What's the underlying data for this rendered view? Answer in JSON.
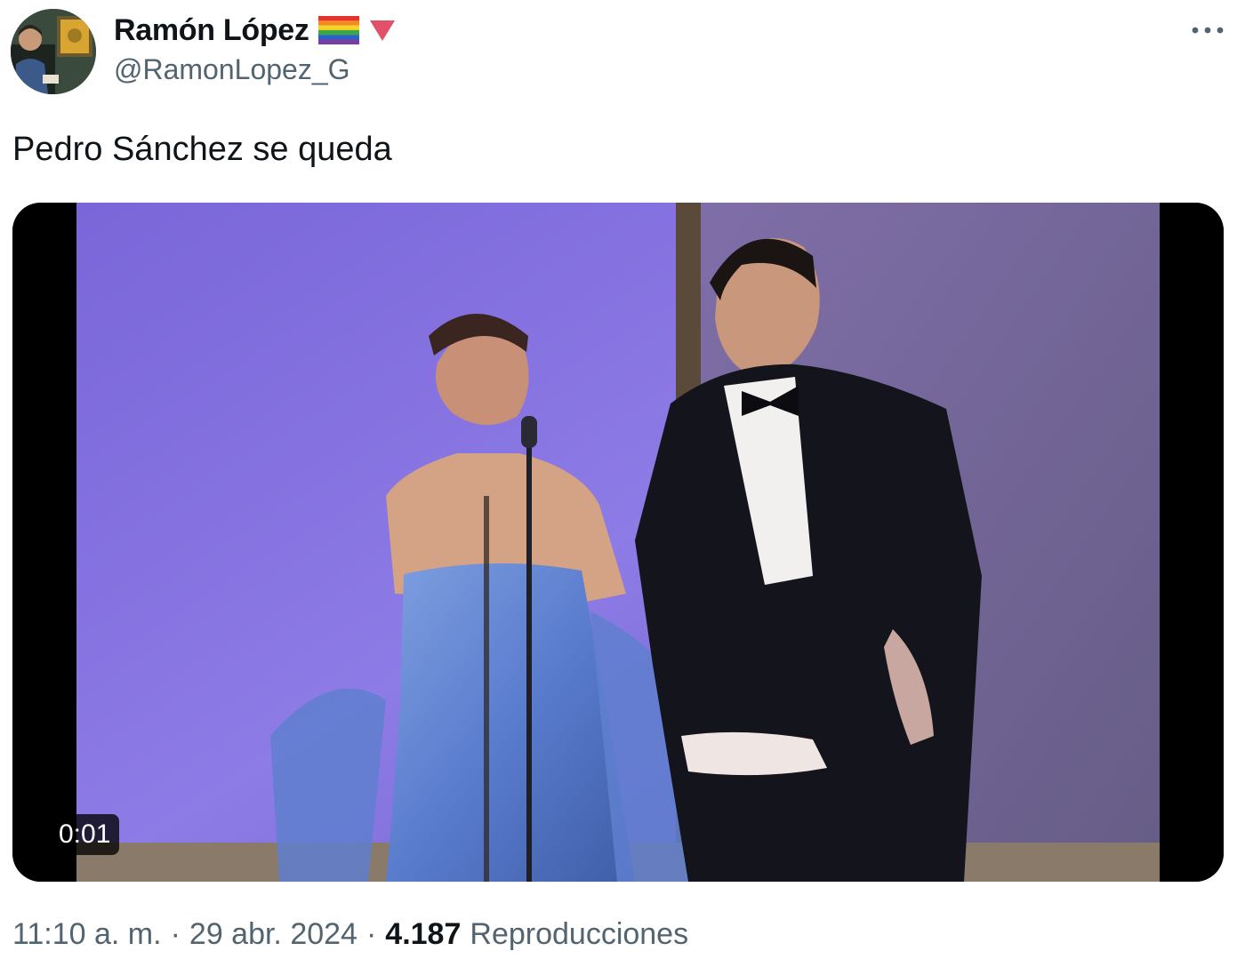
{
  "author": {
    "display_name": "Ramón López",
    "handle": "@RamonLopez_G"
  },
  "tweet": {
    "text": "Pedro Sánchez se queda"
  },
  "media": {
    "duration": "0:01"
  },
  "meta": {
    "time": "11:10 a. m.",
    "separator": "·",
    "date": "29 abr. 2024",
    "views_count": "4.187",
    "views_label": "Reproducciones"
  },
  "icons": {
    "flag": "rainbow-flag-icon",
    "marker": "red-triangle-icon",
    "more": "more-options-icon"
  },
  "colors": {
    "text_primary": "#0f1419",
    "text_secondary": "#536471",
    "triangle": "#e2506a"
  }
}
